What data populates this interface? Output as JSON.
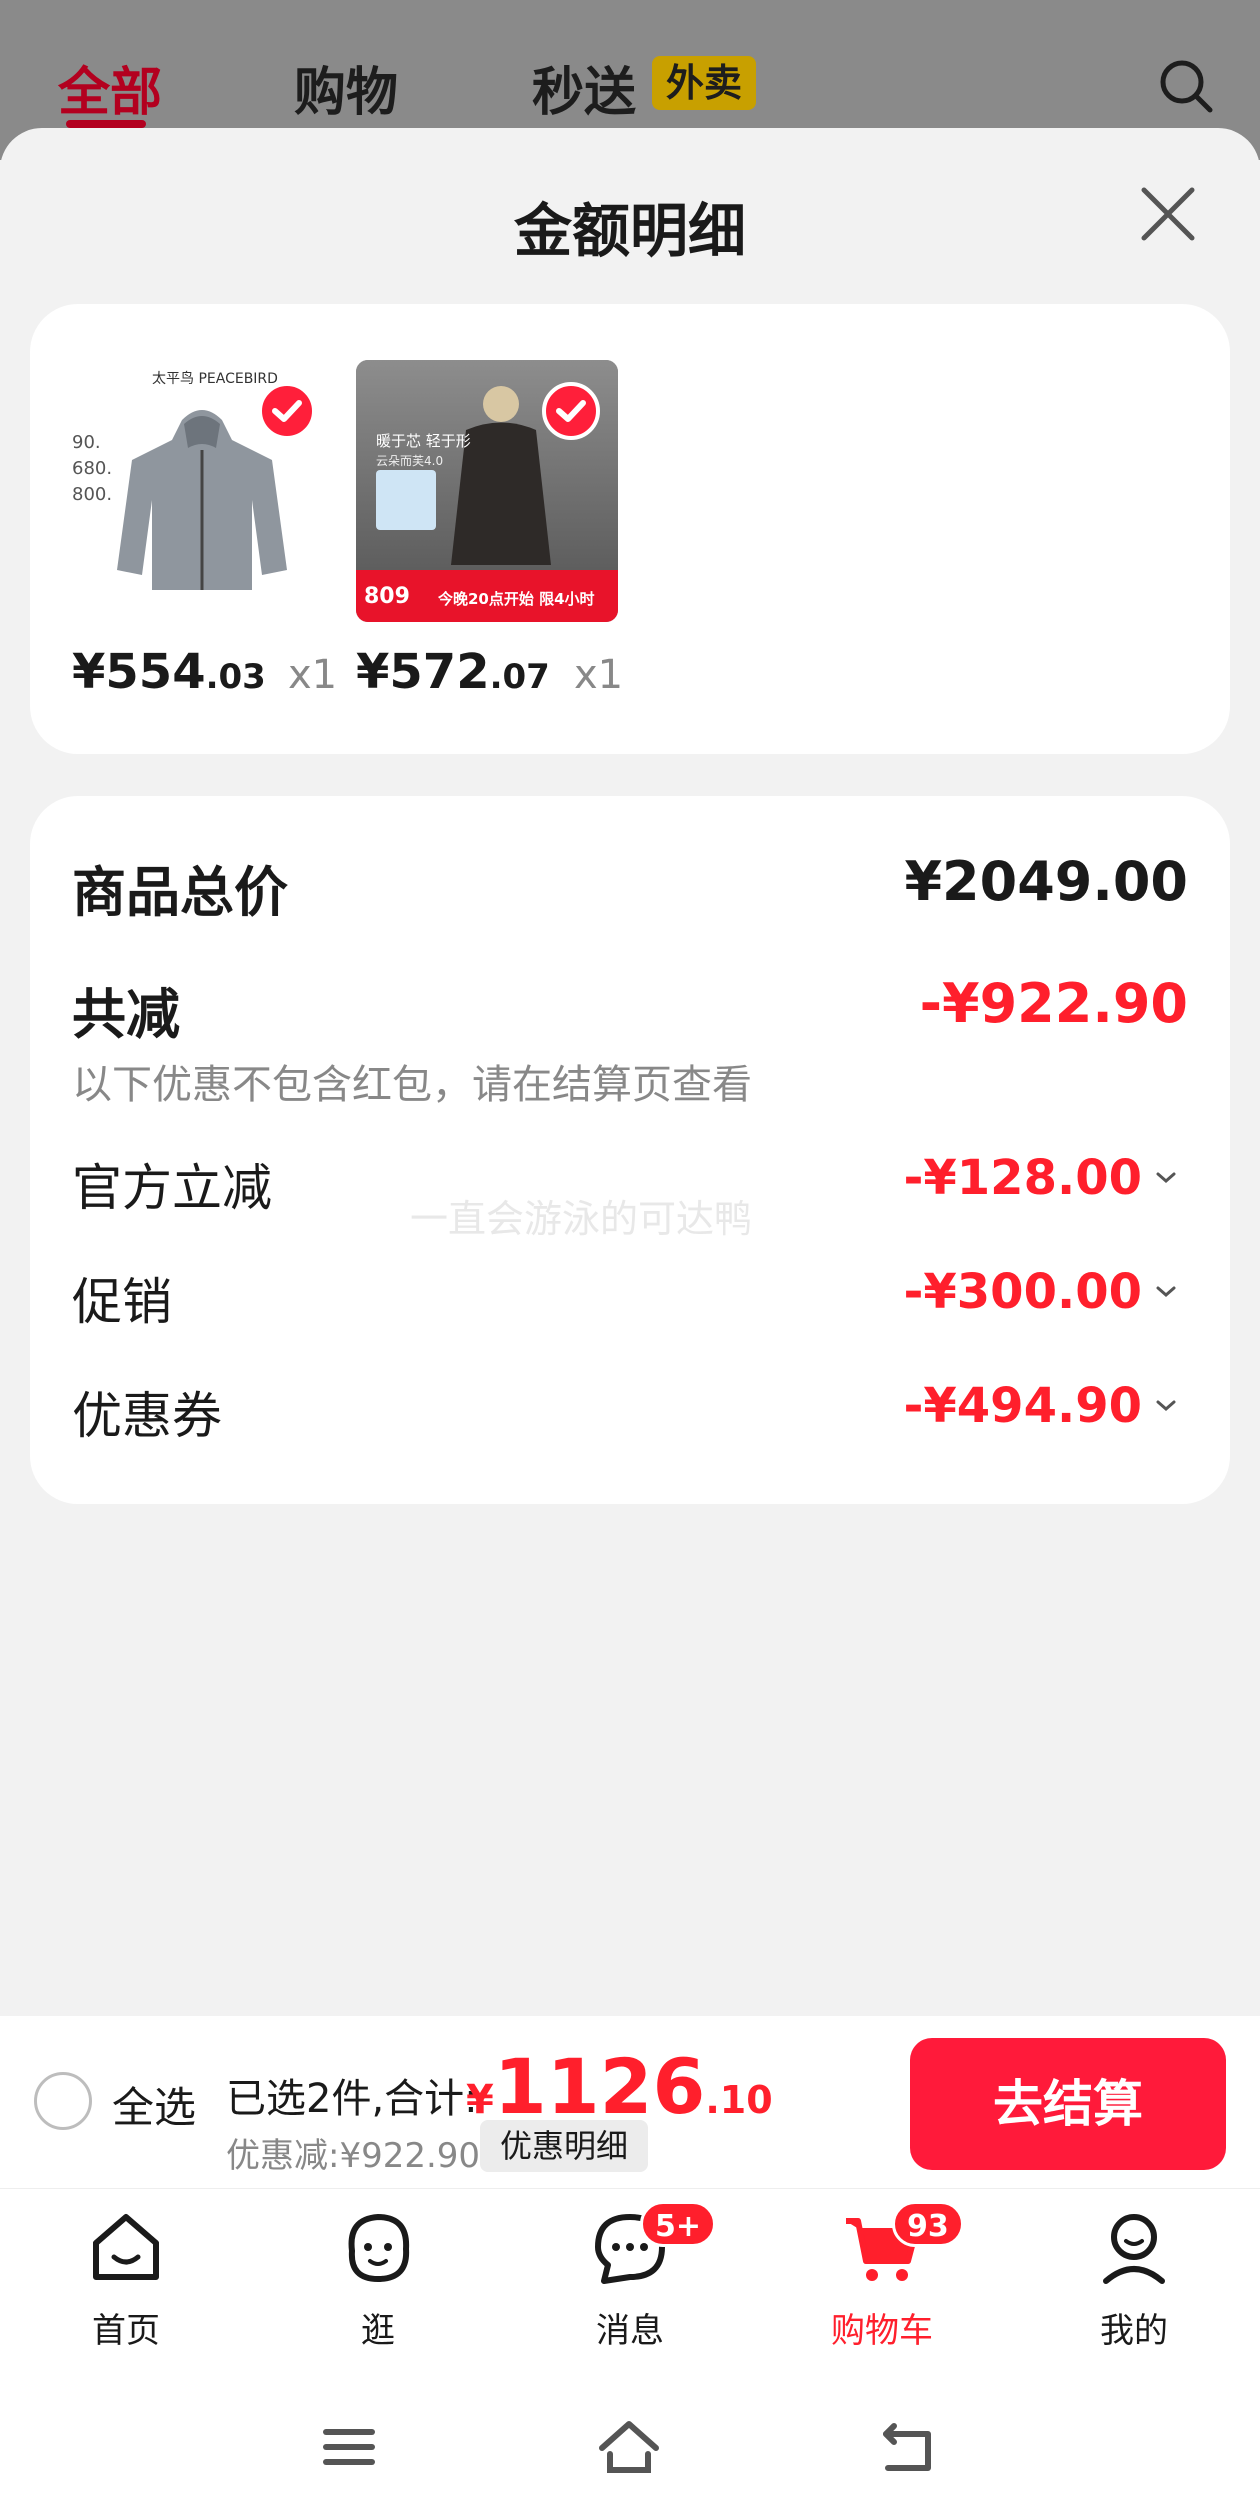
{
  "top_tabs": [
    {
      "label": "全部",
      "active": true
    },
    {
      "label": "购物",
      "active": false
    },
    {
      "label": "秒送",
      "active": false
    }
  ],
  "takeout_tag": "外卖",
  "sheet": {
    "title": "金额明细"
  },
  "products": [
    {
      "brand": "太平鸟 PEACEBIRD",
      "price_int": "¥554",
      "price_dec": ".03",
      "qty": "x1",
      "checked": true
    },
    {
      "price_int": "¥572",
      "price_dec": ".07",
      "qty": "x1",
      "checked": true,
      "label_top": "暖于芯 轻于形",
      "label_sub": "云朵而芙4.0",
      "promo_price": "809",
      "promo_text": "今晚20点开始  限4小时"
    }
  ],
  "summary": {
    "total_label": "商品总价",
    "total_value": "¥2049.00",
    "reduce_label": "共减",
    "reduce_value": "-¥922.90",
    "reduce_note": "以下优惠不包含红包，请在结算页查看",
    "rows": [
      {
        "label": "官方立减",
        "value": "-¥128.00"
      },
      {
        "label": "促销",
        "value": "-¥300.00"
      },
      {
        "label": "优惠券",
        "value": "-¥494.90"
      }
    ],
    "watermark": "一直会游泳的可达鸭"
  },
  "checkout": {
    "select_all": "全选",
    "selected_text": "已选2件,合计:",
    "currency": "¥",
    "total_int": "1126",
    "total_dec": ".10",
    "discount_text": "优惠减:¥922.90",
    "detail_button": "优惠明细",
    "checkout_button": "去结算"
  },
  "bottom_nav": [
    {
      "label": "首页",
      "icon": "home-icon"
    },
    {
      "label": "逛",
      "icon": "face-icon"
    },
    {
      "label": "消息",
      "icon": "message-icon",
      "badge": "5+"
    },
    {
      "label": "购物车",
      "icon": "cart-icon",
      "badge": "93",
      "active": true
    },
    {
      "label": "我的",
      "icon": "user-icon"
    }
  ],
  "colors": {
    "accent": "#ff1f2c",
    "dim_tab_active": "#b3001f"
  }
}
